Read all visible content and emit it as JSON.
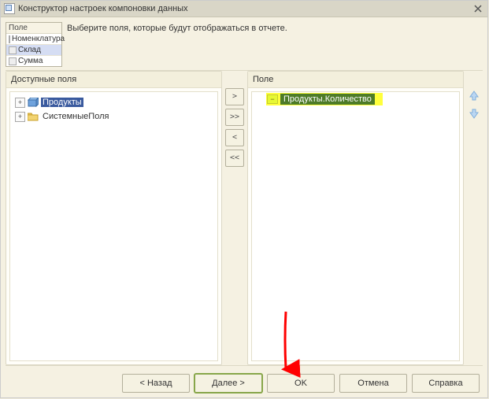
{
  "title": "Конструктор настроек компоновки данных",
  "field_grid": {
    "header": "Поле",
    "rows": [
      "Номенклатура",
      "Склад",
      "Сумма"
    ],
    "selected_index": 1
  },
  "instruction": "Выберите поля, которые будут отображаться в отчете.",
  "left_panel": {
    "header": "Доступные поля"
  },
  "right_panel": {
    "header": "Поле"
  },
  "tree": {
    "items": [
      {
        "label": "Продукты",
        "icon": "cube",
        "expanded": false,
        "selected": true
      },
      {
        "label": "СистемныеПоля",
        "icon": "folder",
        "expanded": false,
        "selected": false
      }
    ]
  },
  "selected_fields": [
    {
      "label": "Продукты.Количество"
    }
  ],
  "mid_buttons": {
    "add": ">",
    "addall": ">>",
    "remove": "<",
    "removeall": "<<"
  },
  "footer": {
    "back": "< Назад",
    "next": "Далее >",
    "ok": "OK",
    "cancel": "Отмена",
    "help": "Справка"
  }
}
